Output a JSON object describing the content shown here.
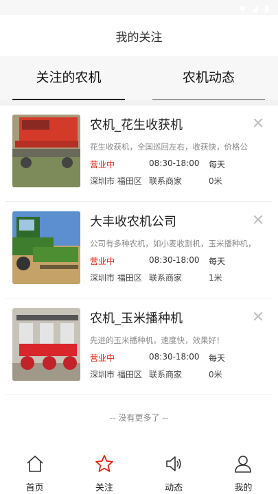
{
  "header": {
    "title": "我的关注"
  },
  "tabs": [
    {
      "label": "关注的农机"
    },
    {
      "label": "农机动态"
    }
  ],
  "items": [
    {
      "title": "农机_花生收获机",
      "desc": "花生收获机，全国巡回左右，收获快，价格公",
      "status": "营业中",
      "hours": "08:30-18:00",
      "days": "每天",
      "city": "深圳市 福田区",
      "contact": "联系商家",
      "distance": "0米"
    },
    {
      "title": "大丰收农机公司",
      "desc": "公司有多种农机，如小麦收割机，玉米播种机，",
      "status": "营业中",
      "hours": "08:30-18:00",
      "days": "每天",
      "city": "深圳市 福田区",
      "contact": "联系商家",
      "distance": "1米"
    },
    {
      "title": "农机_玉米播种机",
      "desc": "先进的玉米播种机，速度快，效果好！",
      "status": "营业中",
      "hours": "08:30-18:00",
      "days": "每天",
      "city": "深圳市 福田区",
      "contact": "联系商家",
      "distance": "0米"
    }
  ],
  "footer_note": "-- 没有更多了 --",
  "nav": [
    {
      "label": "首页",
      "icon": "home-icon"
    },
    {
      "label": "关注",
      "icon": "star-icon",
      "active": true
    },
    {
      "label": "动态",
      "icon": "speaker-icon"
    },
    {
      "label": "我的",
      "icon": "user-icon"
    }
  ],
  "colors": {
    "accent": "#e8220f",
    "status_open": "#e8220f"
  }
}
